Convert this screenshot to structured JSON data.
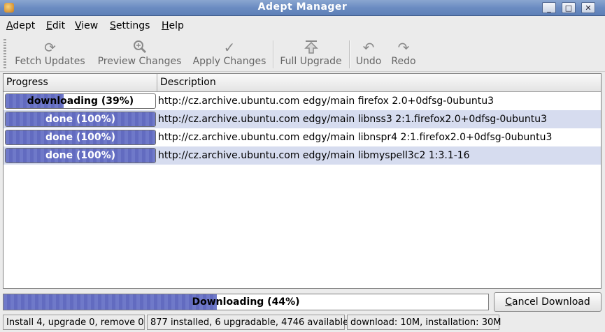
{
  "window": {
    "title": "Adept Manager",
    "buttons": [
      "_",
      "□",
      "✕"
    ]
  },
  "menu": [
    {
      "u": "A",
      "rest": "dept"
    },
    {
      "u": "E",
      "rest": "dit"
    },
    {
      "u": "V",
      "rest": "iew"
    },
    {
      "u": "S",
      "rest": "ettings"
    },
    {
      "u": "H",
      "rest": "elp"
    }
  ],
  "toolbar": {
    "fetch": "Fetch Updates",
    "preview": "Preview Changes",
    "apply": "Apply Changes",
    "upgrade": "Full Upgrade",
    "undo": "Undo",
    "redo": "Redo"
  },
  "icons": {
    "fetch": "refresh-icon",
    "preview": "zoom-icon",
    "apply": "checkmark-icon",
    "upgrade": "upgrade-arrow-icon",
    "undo": "undo-icon",
    "redo": "redo-icon"
  },
  "columns": {
    "progress": "Progress",
    "description": "Description"
  },
  "rows": [
    {
      "progress_text": "downloading (39%)",
      "progress": 39,
      "description": "http://cz.archive.ubuntu.com edgy/main firefox 2.0+0dfsg-0ubuntu3"
    },
    {
      "progress_text": "done (100%)",
      "progress": 100,
      "description": "http://cz.archive.ubuntu.com edgy/main libnss3 2:1.firefox2.0+0dfsg-0ubuntu3"
    },
    {
      "progress_text": "done (100%)",
      "progress": 100,
      "description": "http://cz.archive.ubuntu.com edgy/main libnspr4 2:1.firefox2.0+0dfsg-0ubuntu3"
    },
    {
      "progress_text": "done (100%)",
      "progress": 100,
      "description": "http://cz.archive.ubuntu.com edgy/main libmyspell3c2 1:3.1-16"
    }
  ],
  "overall": {
    "text": "Downloading (44%)",
    "progress": 44
  },
  "cancel": {
    "u": "C",
    "rest": "ancel Download"
  },
  "status": {
    "changes": "Install 4, upgrade 0, remove 0",
    "packages": "877 installed, 6 upgradable, 4746 available",
    "sizes": "download: 10M, installation: 30M"
  },
  "colors": {
    "progress_fill": "#6f79c9",
    "alt_row": "#d6dcef",
    "titlebar": "#6b8cc2"
  }
}
